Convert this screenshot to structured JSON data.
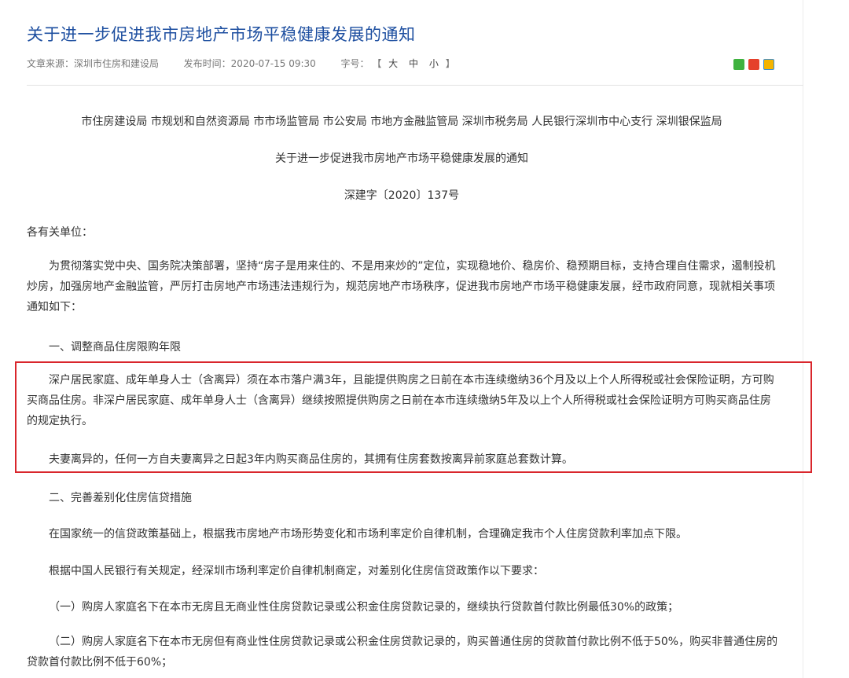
{
  "article": {
    "title": "关于进一步促进我市房地产市场平稳健康发展的通知",
    "source_label": "文章来源：深圳市住房和建设局",
    "publish_time": "发布时间：2020-07-15 09:30",
    "fontsize_label": "字号：",
    "fontsize_open": "【",
    "fontsize_large": "大",
    "fontsize_medium": "中",
    "fontsize_small": "小",
    "fontsize_close": "】"
  },
  "share": {
    "icons": [
      "wechat-icon",
      "weibo-icon",
      "qzone-icon"
    ],
    "colors": {
      "wechat": "#3fb23f",
      "weibo": "#e5402b",
      "qzone": "#f5b400"
    }
  },
  "body": {
    "issuers": "市住房建设局 市规划和自然资源局 市市场监管局 市公安局 市地方金融监管局 深圳市税务局 人民银行深圳市中心支行 深圳银保监局",
    "doc_title": "关于进一步促进我市房地产市场平稳健康发展的通知",
    "doc_number": "深建字〔2020〕137号",
    "salutation": "各有关单位：",
    "intro": "为贯彻落实党中央、国务院决策部署，坚持“房子是用来住的、不是用来炒的”定位，实现稳地价、稳房价、稳预期目标，支持合理自住需求，遏制投机炒房，加强房地产金融监管，严厉打击房地产市场违法违规行为，规范房地产市场秩序，促进我市房地产市场平稳健康发展，经市政府同意，现就相关事项通知如下：",
    "section1_heading": "一、调整商品住房限购年限",
    "section1_p1": "深户居民家庭、成年单身人士（含离异）须在本市落户满3年，且能提供购房之日前在本市连续缴纳36个月及以上个人所得税或社会保险证明，方可购买商品住房。非深户居民家庭、成年单身人士（含离异）继续按照提供购房之日前在本市连续缴纳5年及以上个人所得税或社会保险证明方可购买商品住房的规定执行。",
    "section1_p2": "夫妻离异的，任何一方自夫妻离异之日起3年内购买商品住房的，其拥有住房套数按离异前家庭总套数计算。",
    "section2_heading": "二、完善差别化住房信贷措施",
    "section2_p1": "在国家统一的信贷政策基础上，根据我市房地产市场形势变化和市场利率定价自律机制，合理确定我市个人住房贷款利率加点下限。",
    "section2_p2": "根据中国人民银行有关规定，经深圳市场利率定价自律机制商定，对差别化住房信贷政策作以下要求：",
    "item1": "（一）购房人家庭名下在本市无房且无商业性住房贷款记录或公积金住房贷款记录的，继续执行贷款首付款比例最低30%的政策；",
    "item2": "（二）购房人家庭名下在本市无房但有商业性住房贷款记录或公积金住房贷款记录的，购买普通住房的贷款首付款比例不低于50%，购买非普通住房的贷款首付款比例不低于60%；"
  },
  "colors": {
    "title": "#1e4fa0",
    "highlight_border": "#d9262c"
  }
}
